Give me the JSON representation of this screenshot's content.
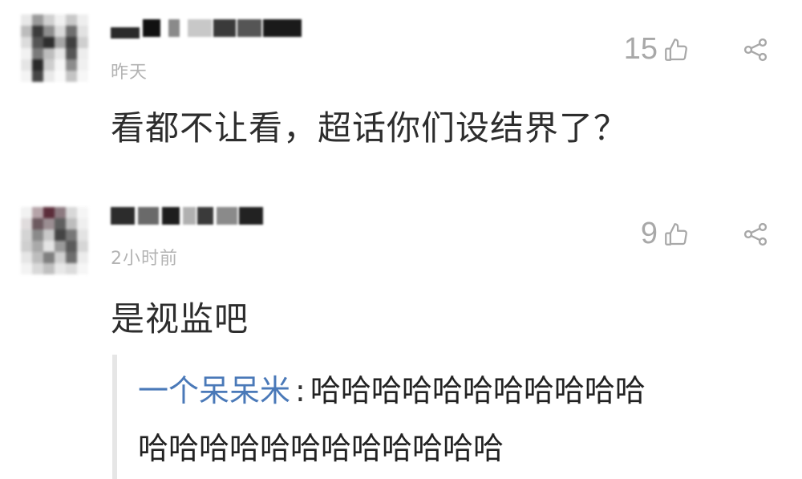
{
  "comments": [
    {
      "time": "昨天",
      "likes": "15",
      "text": "看都不让看，超话你们设结界了？"
    },
    {
      "time": "2小时前",
      "likes": "9",
      "text": "是视监吧",
      "reply": {
        "user": "一个呆呆米",
        "colon": ":",
        "text_line1": "哈哈哈哈哈哈哈哈哈哈哈",
        "text_line2": "哈哈哈哈哈哈哈哈哈哈哈哈"
      }
    }
  ],
  "icons": {
    "like": "thumbs-up-icon",
    "share": "share-icon"
  },
  "colors": {
    "text": "#2d2d2d",
    "meta": "#b3b3b3",
    "reply_user": "#4a79b8",
    "reply_border": "#e6e6e6"
  }
}
